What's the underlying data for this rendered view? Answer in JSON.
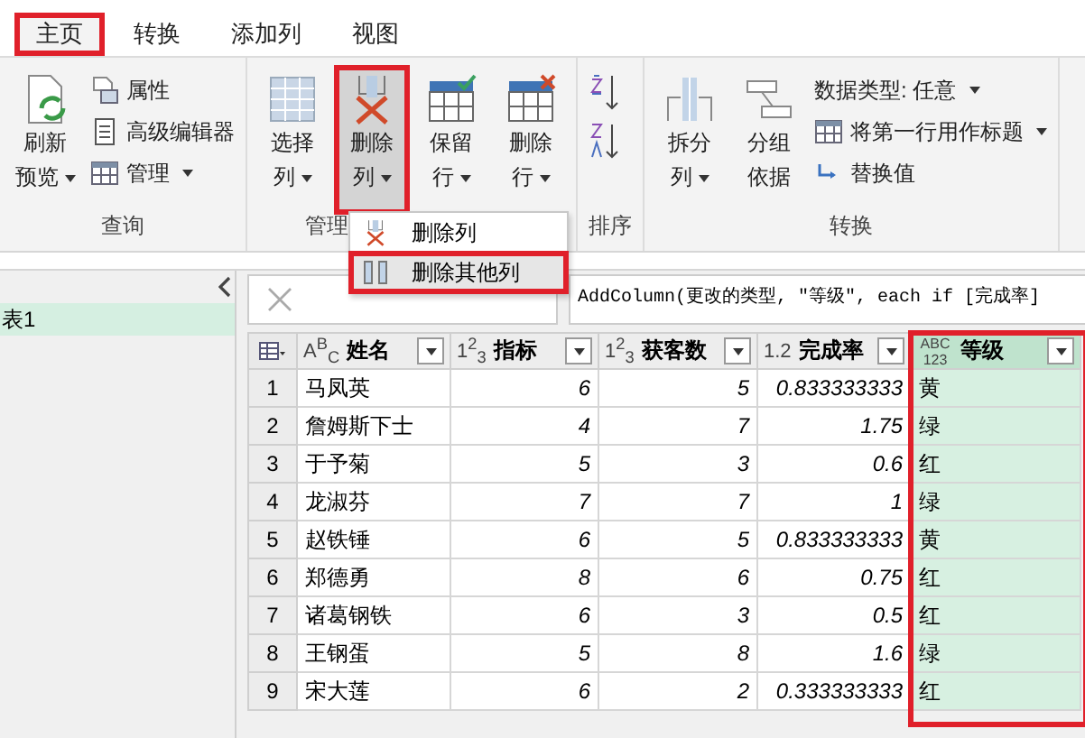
{
  "tabs": [
    {
      "label": "主页",
      "selected": true,
      "highlighted": true
    },
    {
      "label": "转换",
      "selected": false,
      "highlighted": false
    },
    {
      "label": "添加列",
      "selected": false,
      "highlighted": false
    },
    {
      "label": "视图",
      "selected": false,
      "highlighted": false
    }
  ],
  "ribbon": [
    {
      "label": "查询",
      "items": [
        {
          "kind": "big",
          "label": "刷新预览",
          "dropdown": true,
          "highlighted": false
        },
        {
          "kind": "stack",
          "items": [
            {
              "label": "属性",
              "dropdown": false
            },
            {
              "label": "高级编辑器",
              "dropdown": false
            },
            {
              "label": "管理",
              "dropdown": true
            }
          ]
        }
      ]
    },
    {
      "label": "管理",
      "items": [
        {
          "kind": "big",
          "label": "选择列",
          "dropdown": true,
          "highlighted": false
        },
        {
          "kind": "big",
          "label": "删除列",
          "dropdown": true,
          "highlighted": true
        },
        {
          "kind": "big",
          "label": "保留行",
          "dropdown": true,
          "highlighted": false
        },
        {
          "kind": "big",
          "label": "删除行",
          "dropdown": true,
          "highlighted": false
        }
      ]
    },
    {
      "label": "排序",
      "items": [
        {
          "kind": "sort"
        }
      ]
    },
    {
      "label": "转换",
      "items": [
        {
          "kind": "big",
          "label": "拆分列",
          "dropdown": true,
          "highlighted": false
        },
        {
          "kind": "big",
          "label": "分组依据",
          "dropdown": false,
          "highlighted": false
        },
        {
          "kind": "stack",
          "items": [
            {
              "label": "数据类型: 任意",
              "dropdown": true
            },
            {
              "label": "将第一行用作标题",
              "dropdown": true
            },
            {
              "label": "替换值",
              "dropdown": false
            }
          ]
        }
      ]
    }
  ],
  "menu": [
    {
      "label": "删除列",
      "highlighted": false
    },
    {
      "label": "删除其他列",
      "highlighted": true
    }
  ],
  "queries": [
    {
      "label": "表1",
      "selected": true
    }
  ],
  "formula": "AddColumn(更改的类型, \"等级\", each if [完成率]",
  "table": {
    "columns": [
      {
        "type_label": "A$^{B}$$_{C}$",
        "name": "姓名",
        "kind": "text",
        "highlighted": false
      },
      {
        "type_label": "1$^{2}$$_{3}$",
        "name": "指标",
        "kind": "number",
        "highlighted": false
      },
      {
        "type_label": "1$^{2}$$_{3}$",
        "name": "获客数",
        "kind": "number",
        "highlighted": false
      },
      {
        "type_label": "1.2",
        "name": "完成率",
        "kind": "number",
        "highlighted": false
      },
      {
        "type_label": "ABC 123",
        "name": "等级",
        "kind": "text",
        "highlighted": true
      }
    ],
    "rows": [
      {
        "index": "1",
        "cells": [
          "马凤英",
          "6",
          "5",
          "0.833333333",
          "黄"
        ]
      },
      {
        "index": "2",
        "cells": [
          "詹姆斯下士",
          "4",
          "7",
          "1.75",
          "绿"
        ]
      },
      {
        "index": "3",
        "cells": [
          "于予菊",
          "5",
          "3",
          "0.6",
          "红"
        ]
      },
      {
        "index": "4",
        "cells": [
          "龙淑芬",
          "7",
          "7",
          "1",
          "绿"
        ]
      },
      {
        "index": "5",
        "cells": [
          "赵铁锤",
          "6",
          "5",
          "0.833333333",
          "黄"
        ]
      },
      {
        "index": "6",
        "cells": [
          "郑德勇",
          "8",
          "6",
          "0.75",
          "红"
        ]
      },
      {
        "index": "7",
        "cells": [
          "诸葛钢铁",
          "6",
          "3",
          "0.5",
          "红"
        ]
      },
      {
        "index": "8",
        "cells": [
          "王钢蛋",
          "5",
          "8",
          "1.6",
          "绿"
        ]
      },
      {
        "index": "9",
        "cells": [
          "宋大莲",
          "6",
          "2",
          "0.333333333",
          "红"
        ]
      }
    ]
  }
}
